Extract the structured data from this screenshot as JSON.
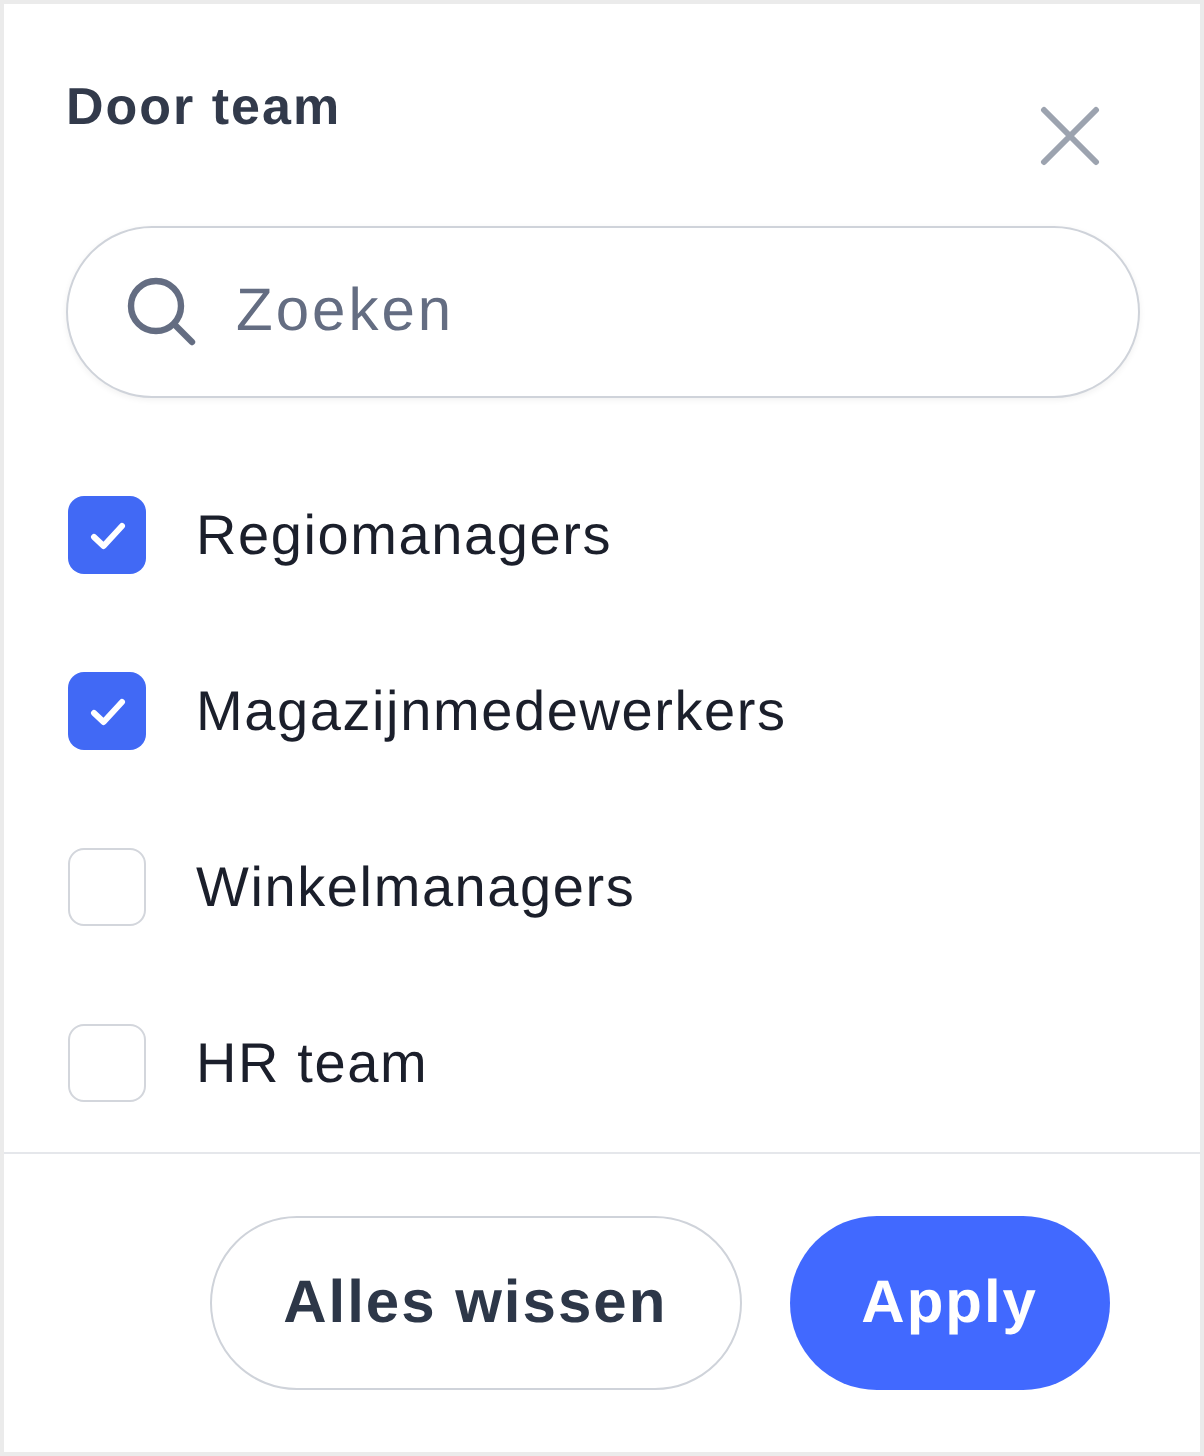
{
  "panel": {
    "title": "Door team"
  },
  "search": {
    "placeholder": "Zoeken"
  },
  "options": [
    {
      "label": "Regiomanagers",
      "checked": true
    },
    {
      "label": "Magazijnmedewerkers",
      "checked": true
    },
    {
      "label": "Winkelmanagers",
      "checked": false
    },
    {
      "label": "HR team",
      "checked": false
    }
  ],
  "buttons": [
    {
      "label": "Alles wissen",
      "kind": "secondary"
    },
    {
      "label": "Apply",
      "kind": "primary"
    }
  ]
}
